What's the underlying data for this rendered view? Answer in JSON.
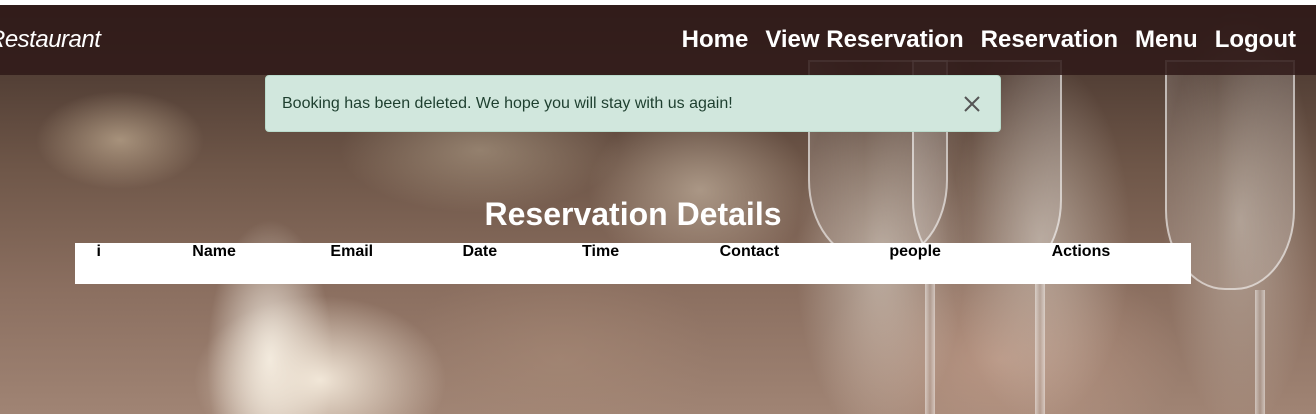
{
  "navbar": {
    "brand": "Restaurant",
    "links": [
      "Home",
      "View Reservation",
      "Reservation",
      "Menu",
      "Logout"
    ]
  },
  "alert": {
    "message": "Booking has been deleted. We hope you will stay with us again!",
    "close_icon": "close-icon"
  },
  "page": {
    "title": "Reservation Details"
  },
  "table": {
    "columns": [
      "i",
      "Name",
      "Email",
      "Date",
      "Time",
      "Contact",
      "people",
      "Actions"
    ],
    "rows": []
  },
  "colors": {
    "navbar_bg": "#301a18",
    "alert_bg": "#d1e7dd",
    "alert_text": "#1e3f2f",
    "table_bg": "#ffffff"
  }
}
